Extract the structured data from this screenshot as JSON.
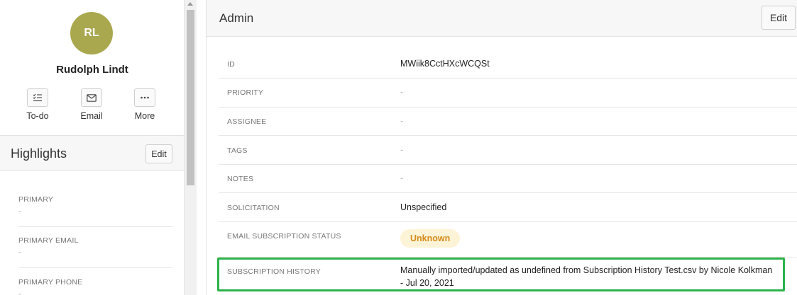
{
  "sidebar": {
    "avatar_initials": "RL",
    "contact_name": "Rudolph Lindt",
    "actions": [
      {
        "label": "To-do",
        "icon": "todo-list-icon"
      },
      {
        "label": "Email",
        "icon": "envelope-icon"
      },
      {
        "label": "More",
        "icon": "ellipsis-icon"
      }
    ],
    "highlights": {
      "title": "Highlights",
      "edit_label": "Edit",
      "items": [
        {
          "label": "PRIMARY",
          "value": "-"
        },
        {
          "label": "PRIMARY EMAIL",
          "value": "-"
        },
        {
          "label": "PRIMARY PHONE",
          "value": "-"
        }
      ]
    }
  },
  "main": {
    "title": "Admin",
    "edit_label": "Edit",
    "fields": [
      {
        "label": "ID",
        "value": "MWiik8CctHXcWCQSt"
      },
      {
        "label": "PRIORITY",
        "value": "-"
      },
      {
        "label": "ASSIGNEE",
        "value": "-"
      },
      {
        "label": "TAGS",
        "value": "-"
      },
      {
        "label": "NOTES",
        "value": "-"
      },
      {
        "label": "SOLICITATION",
        "value": "Unspecified"
      },
      {
        "label": "EMAIL SUBSCRIPTION STATUS",
        "value": "Unknown"
      },
      {
        "label": "SUBSCRIPTION HISTORY",
        "value_line1": "Manually imported/updated as undefined from Subscription History Test.csv by Nicole Kolkman",
        "value_line2": "- Jul 20, 2021"
      }
    ]
  },
  "colors": {
    "avatar": "#a9a84e",
    "badge_bg": "#fdf3d6",
    "badge_text": "#d58b1b",
    "highlight_border": "#2db34a"
  }
}
